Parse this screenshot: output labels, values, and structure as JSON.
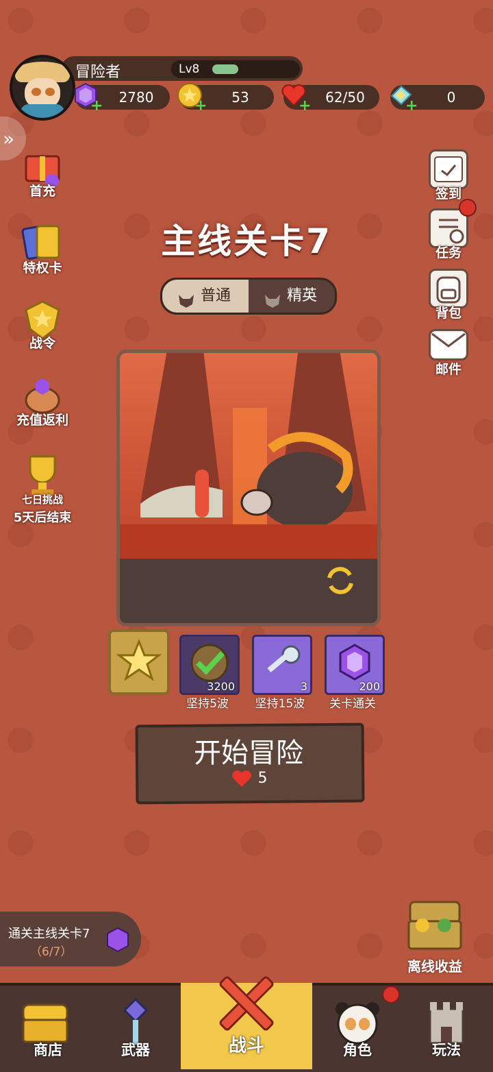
{
  "player": {
    "name": "冒险者",
    "level": "Lv8",
    "xp_fraction": 0.22
  },
  "resources": [
    {
      "icon": "purple-gem-icon",
      "value": "2780"
    },
    {
      "icon": "gold-coin-icon",
      "value": "53"
    },
    {
      "icon": "heart-icon",
      "value": "62/50"
    },
    {
      "icon": "ticket-icon",
      "value": "0"
    }
  ],
  "left_menu": [
    {
      "label": "首充",
      "icon": "first-recharge-gift-icon"
    },
    {
      "label": "特权卡",
      "icon": "privilege-card-icon"
    },
    {
      "label": "战令",
      "icon": "battle-pass-icon"
    },
    {
      "label": "充值返利",
      "icon": "recharge-rebate-icon"
    },
    {
      "label": "七日挑战",
      "sub": "5天后结束",
      "icon": "trophy-icon"
    }
  ],
  "right_menu": [
    {
      "label": "签到",
      "icon": "calendar-check-icon"
    },
    {
      "label": "任务",
      "icon": "task-list-icon",
      "badge": true
    },
    {
      "label": "背包",
      "icon": "backpack-icon"
    },
    {
      "label": "邮件",
      "icon": "mail-icon"
    }
  ],
  "stage": {
    "title": "主线关卡7",
    "tabs": [
      "普通",
      "精英"
    ],
    "active_tab": "普通"
  },
  "rewards": [
    {
      "label": "坚持5波",
      "count": "3200",
      "icon": "green-check-medal-icon"
    },
    {
      "label": "坚持15波",
      "count": "3",
      "icon": "key-icon"
    },
    {
      "label": "关卡通关",
      "count": "200",
      "icon": "purple-gem-icon"
    }
  ],
  "start": {
    "label": "开始冒险",
    "cost": "5"
  },
  "quest": {
    "text": "通关主线关卡7",
    "progress": "（6/7）"
  },
  "offline": {
    "label": "离线收益"
  },
  "nav": [
    {
      "label": "商店",
      "icon": "shop-chest-icon"
    },
    {
      "label": "武器",
      "icon": "weapon-icon"
    },
    {
      "label": "战斗",
      "icon": "crossed-swords-icon",
      "active": true
    },
    {
      "label": "角色",
      "icon": "panda-icon",
      "badge": true
    },
    {
      "label": "玩法",
      "icon": "castle-icon"
    }
  ]
}
